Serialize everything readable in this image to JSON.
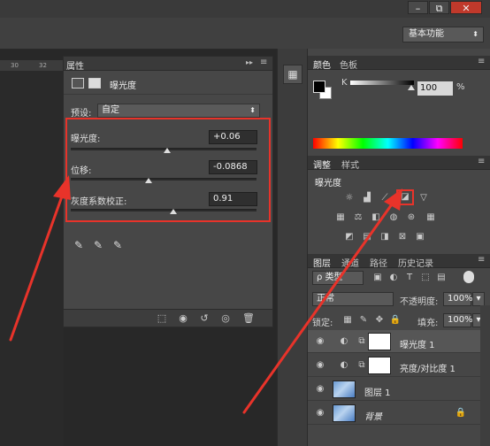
{
  "window": {
    "minimize": "–",
    "restore": "⧉",
    "close": "✕"
  },
  "workspace": {
    "label": "基本功能"
  },
  "ruler": {
    "labels": [
      "30",
      "32"
    ]
  },
  "properties": {
    "tab": "属性",
    "header_title": "曝光度",
    "preset_label": "预设:",
    "preset_value": "自定",
    "params": [
      {
        "label": "曝光度:",
        "value": "+0.06",
        "position": 0.52
      },
      {
        "label": "位移:",
        "value": "-0.0868",
        "position": 0.42
      },
      {
        "label": "灰度系数校正:",
        "value": "0.91",
        "position": 0.55
      }
    ]
  },
  "color_panel": {
    "tabs": [
      "颜色",
      "色板"
    ],
    "channel": "K",
    "value": "100",
    "unit": "%"
  },
  "adjustments": {
    "tabs": [
      "调整",
      "样式"
    ],
    "title": "曝光度"
  },
  "layers_panel": {
    "tabs": [
      "图层",
      "通道",
      "路径",
      "历史记录"
    ],
    "filter": "ρ 类型",
    "blend_mode": "正常",
    "opacity_label": "不透明度:",
    "opacity": "100%",
    "lock_label": "锁定:",
    "fill_label": "填充:",
    "fill": "100%",
    "layers": [
      {
        "name": "曝光度 1",
        "type": "adjust",
        "selected": true
      },
      {
        "name": "亮度/对比度 1",
        "type": "adjust",
        "selected": false
      },
      {
        "name": "图层 1",
        "type": "image",
        "selected": false
      },
      {
        "name": "背景",
        "type": "image",
        "selected": false,
        "locked": true
      }
    ]
  },
  "colors": {
    "annotation": "#e8332a",
    "panel": "#474747"
  }
}
